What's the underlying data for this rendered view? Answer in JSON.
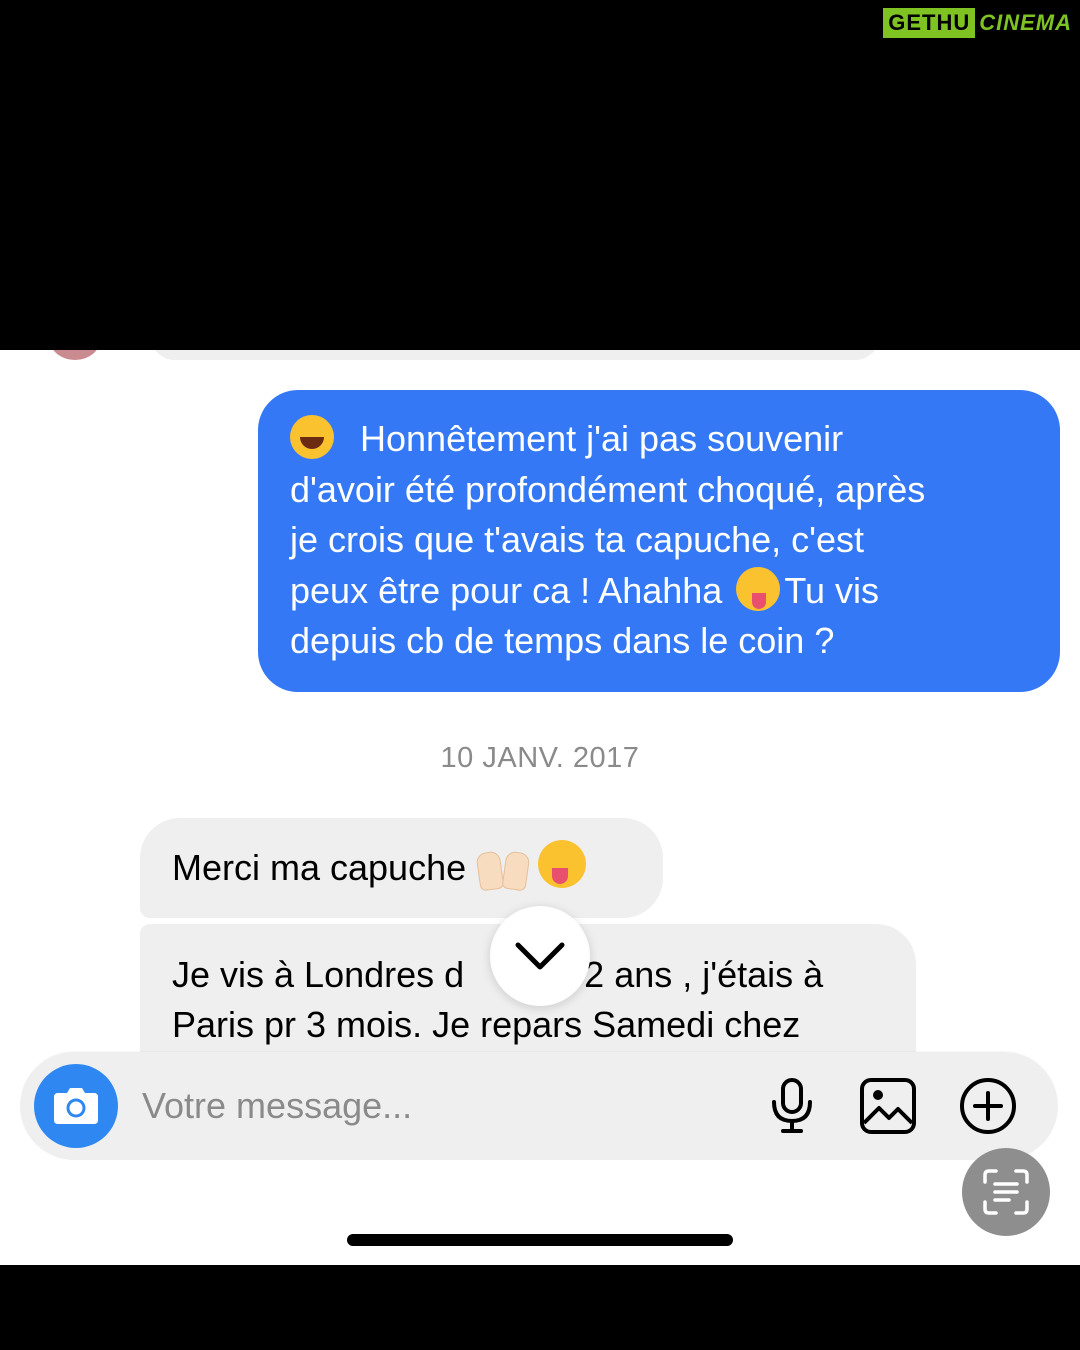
{
  "watermark": {
    "left": "GETHU",
    "right": "CINEMA"
  },
  "conversation": {
    "outgoing": {
      "line1": "Honnêtement j'ai pas souvenir",
      "line2": "d'avoir été profondément choqué, après",
      "line3": "je crois que t'avais ta capuche, c'est",
      "line4_a": "peux être pour ca ! Ahahha",
      "line4_b": "Tu vis",
      "line5": "depuis cb de temps dans le coin ?"
    },
    "date_separator": "10 JANV. 2017",
    "incoming_1": "Merci ma capuche",
    "incoming_2": {
      "line1_a": "Je vis à Londres d",
      "line1_b": "s 2 ans , j'étais à",
      "line2": "Paris pr 3 mois. Je repars Samedi chez"
    }
  },
  "composer": {
    "placeholder": "Votre message..."
  },
  "icons": [
    "camera-icon",
    "mic-icon",
    "gallery-icon",
    "plus-circle-icon",
    "chevron-down-icon",
    "scan-text-icon"
  ],
  "colors": {
    "outgoing_bubble": "#3478f6",
    "incoming_bubble": "#efefef",
    "camera_button": "#2f88f2"
  }
}
